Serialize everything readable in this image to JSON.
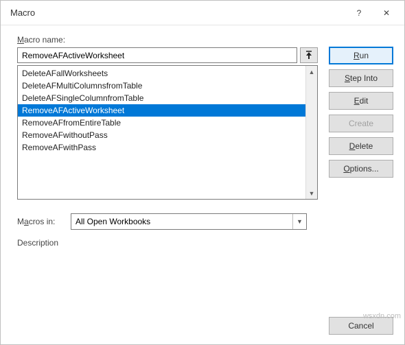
{
  "titlebar": {
    "title": "Macro",
    "help_icon": "?",
    "close_icon": "✕"
  },
  "labels": {
    "macro_name": "Macro name:",
    "macros_in": "Macros in:",
    "description": "Description"
  },
  "name_input": {
    "value": "RemoveAFActiveWorksheet"
  },
  "macro_list": {
    "items": [
      "DeleteAFallWorksheets",
      "DeleteAFMultiColumnsfromTable",
      "DeleteAFSingleColumnfromTable",
      "RemoveAFActiveWorksheet",
      "RemoveAFfromEntireTable",
      "RemoveAFwithoutPass",
      "RemoveAFwithPass"
    ],
    "selected_index": 3
  },
  "buttons": {
    "run": "Run",
    "step_into": "Step Into",
    "edit": "Edit",
    "create": "Create",
    "delete": "Delete",
    "options": "Options...",
    "cancel": "Cancel"
  },
  "macros_in_combo": {
    "selected": "All Open Workbooks"
  },
  "watermark": "wsxdn.com"
}
